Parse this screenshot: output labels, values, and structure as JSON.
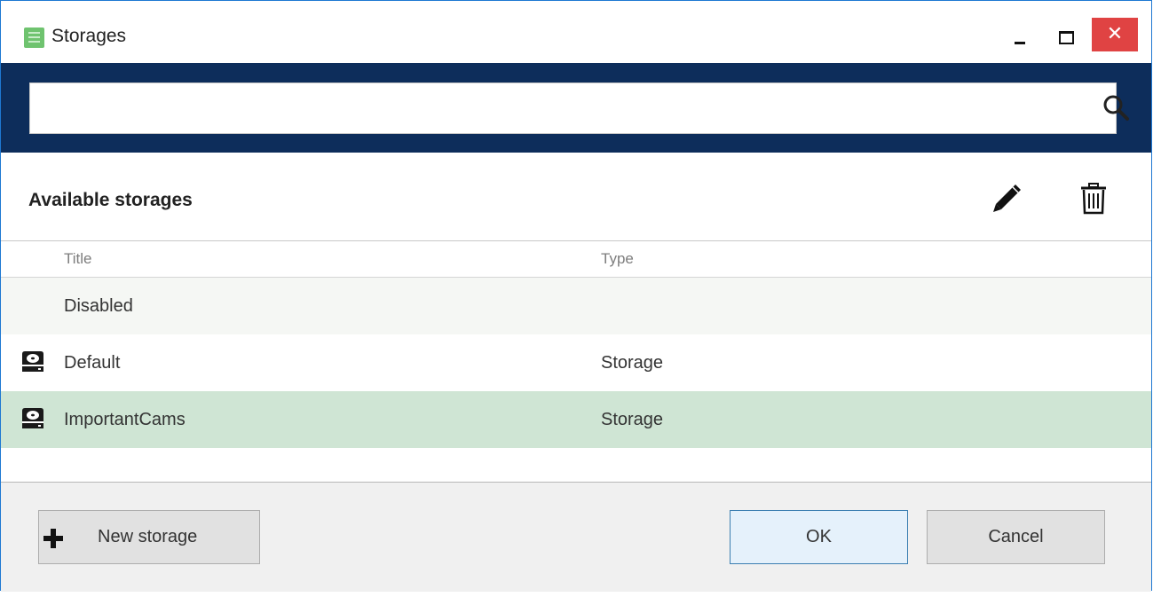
{
  "window": {
    "title": "Storages",
    "close_glyph": "✕",
    "icons": {
      "app": "storage-list-icon",
      "minimize": "minimize-icon",
      "maximize": "maximize-icon",
      "close": "close-icon"
    },
    "colors": {
      "border": "#1e78d2",
      "close_button": "#e04343"
    }
  },
  "search": {
    "value": "",
    "placeholder": "",
    "icon": "search-icon",
    "band_color": "#0d2d5b"
  },
  "storages_panel": {
    "title": "Available storages",
    "toolbar": {
      "edit_icon": "pencil-icon",
      "delete_icon": "trash-icon"
    },
    "columns": [
      "Title",
      "Type"
    ],
    "rows": [
      {
        "title": "Disabled",
        "type": "",
        "icon": null,
        "selected": false
      },
      {
        "title": "Default",
        "type": "Storage",
        "icon": "hard-drive-icon",
        "selected": false
      },
      {
        "title": "ImportantCams",
        "type": "Storage",
        "icon": "hard-drive-icon",
        "selected": true
      }
    ],
    "colors": {
      "selected_row": "#cfe5d4"
    }
  },
  "footer": {
    "new_storage_label": "New storage",
    "new_storage_icon": "plus-icon",
    "ok_label": "OK",
    "cancel_label": "Cancel"
  }
}
